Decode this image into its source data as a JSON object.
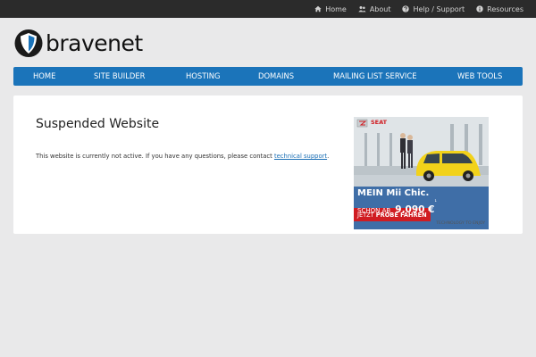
{
  "topnav": {
    "items": [
      {
        "label": "Home",
        "icon": "home-icon"
      },
      {
        "label": "About",
        "icon": "users-icon"
      },
      {
        "label": "Help / Support",
        "icon": "question-circle-icon"
      },
      {
        "label": "Resources",
        "icon": "info-circle-icon"
      }
    ]
  },
  "brand": {
    "name": "bravenet"
  },
  "mainnav": {
    "items": [
      "HOME",
      "SITE BUILDER",
      "HOSTING",
      "DOMAINS",
      "MAILING LIST SERVICE",
      "WEB TOOLS"
    ]
  },
  "content": {
    "title": "Suspended Website",
    "message_prefix": "This website is currently not active. If you have any questions, please contact ",
    "link_text": "technical support",
    "message_suffix": "."
  },
  "ad": {
    "brand": "SEAT",
    "headline": "MEIN Mii Chic.",
    "price_prefix": "SCHON AB",
    "price": "9.090 €",
    "price_footnote": "¹",
    "cta_prefix": "JETZT",
    "cta": "PROBE FAHREN",
    "tagline": "TECHNOLOGY TO ENJOY"
  },
  "colors": {
    "topbar": "#2b2b2b",
    "nav_blue": "#1b74ba",
    "background": "#e9e9ea",
    "link": "#1b6fb5",
    "ad_yellow": "#f2d21a",
    "ad_red": "#d01c22"
  }
}
